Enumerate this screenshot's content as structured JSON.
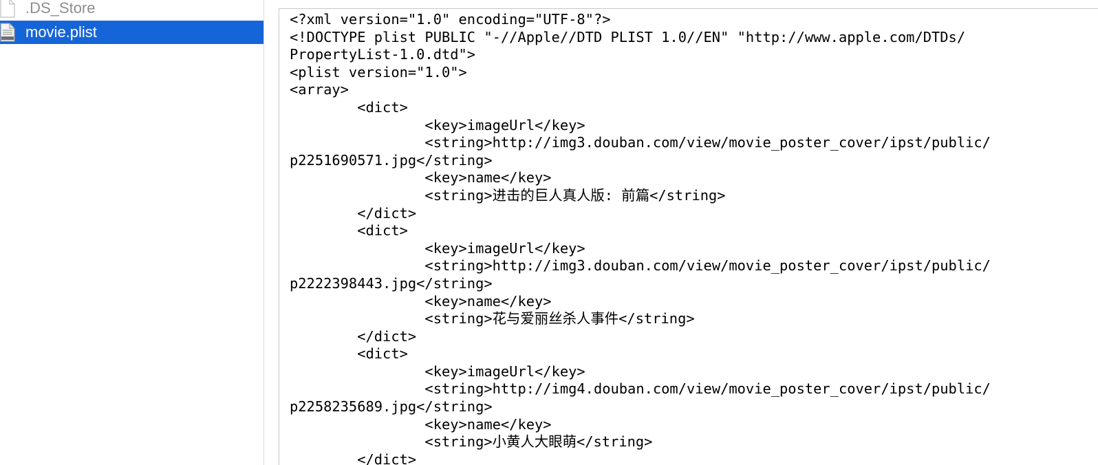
{
  "sidebar": {
    "files": [
      {
        "name": ".DS_Store",
        "icon": "document-icon",
        "selected": false
      },
      {
        "name": "movie.plist",
        "icon": "plist-file-icon",
        "selected": true
      }
    ],
    "selection_color": "#1665d8"
  },
  "preview": {
    "lines": [
      "<?xml version=\"1.0\" encoding=\"UTF-8\"?>",
      "<!DOCTYPE plist PUBLIC \"-//Apple//DTD PLIST 1.0//EN\" \"http://www.apple.com/DTDs/",
      "PropertyList-1.0.dtd\">",
      "<plist version=\"1.0\">",
      "<array>",
      "\t<dict>",
      "\t\t<key>imageUrl</key>",
      "\t\t<string>http://img3.douban.com/view/movie_poster_cover/ipst/public/",
      "p2251690571.jpg</string>",
      "\t\t<key>name</key>",
      "\t\t<string>进击的巨人真人版: 前篇</string>",
      "\t</dict>",
      "\t<dict>",
      "\t\t<key>imageUrl</key>",
      "\t\t<string>http://img3.douban.com/view/movie_poster_cover/ipst/public/",
      "p2222398443.jpg</string>",
      "\t\t<key>name</key>",
      "\t\t<string>花与爱丽丝杀人事件</string>",
      "\t</dict>",
      "\t<dict>",
      "\t\t<key>imageUrl</key>",
      "\t\t<string>http://img4.douban.com/view/movie_poster_cover/ipst/public/",
      "p2258235689.jpg</string>",
      "\t\t<key>name</key>",
      "\t\t<string>小黄人大眼萌</string>",
      "\t</dict>"
    ]
  }
}
